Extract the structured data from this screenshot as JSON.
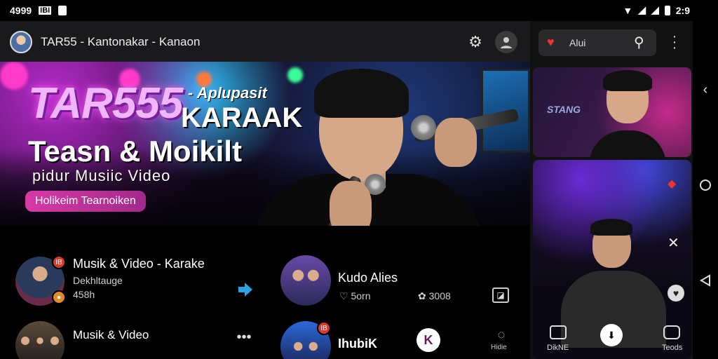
{
  "status_bar": {
    "time_left": "4999",
    "network_label": "IBI",
    "time_right": "2:9"
  },
  "app_bar": {
    "title": "TAR55 - Kantonakar - Kanaon",
    "settings_icon": "gear-icon",
    "account_icon": "avatar-icon"
  },
  "hero": {
    "title_line1": "TAR555",
    "title_suffix": "KARAAK",
    "title_tag": "- Aplupasit",
    "title_line2": "Teasn & Moikilt",
    "subtitle": "pidur Musiic Video",
    "cta_label": "Holikeim Tearnoiken"
  },
  "list": {
    "items": [
      {
        "title": "Musik & Video - Karake",
        "sub1": "Dekhltauge",
        "sub2": "458h",
        "badge": "IB"
      },
      {
        "title": "Kudo Alies",
        "likes": "5orn",
        "views": "3008"
      },
      {
        "title": "Musik & Video"
      },
      {
        "title": "IhubiK",
        "badge": "IB",
        "action": "K",
        "chat_label": "Hidie"
      }
    ]
  },
  "right_pane": {
    "search_text": "Alui",
    "thumb1_label": "STANG",
    "thumb2_label_left": "DikNE",
    "thumb2_label_right": "Teods"
  },
  "colors": {
    "accent_pink": "#d83aa5",
    "badge_red": "#d63a2f",
    "badge_orange": "#e08a2a",
    "play_blue": "#29a3e6"
  }
}
